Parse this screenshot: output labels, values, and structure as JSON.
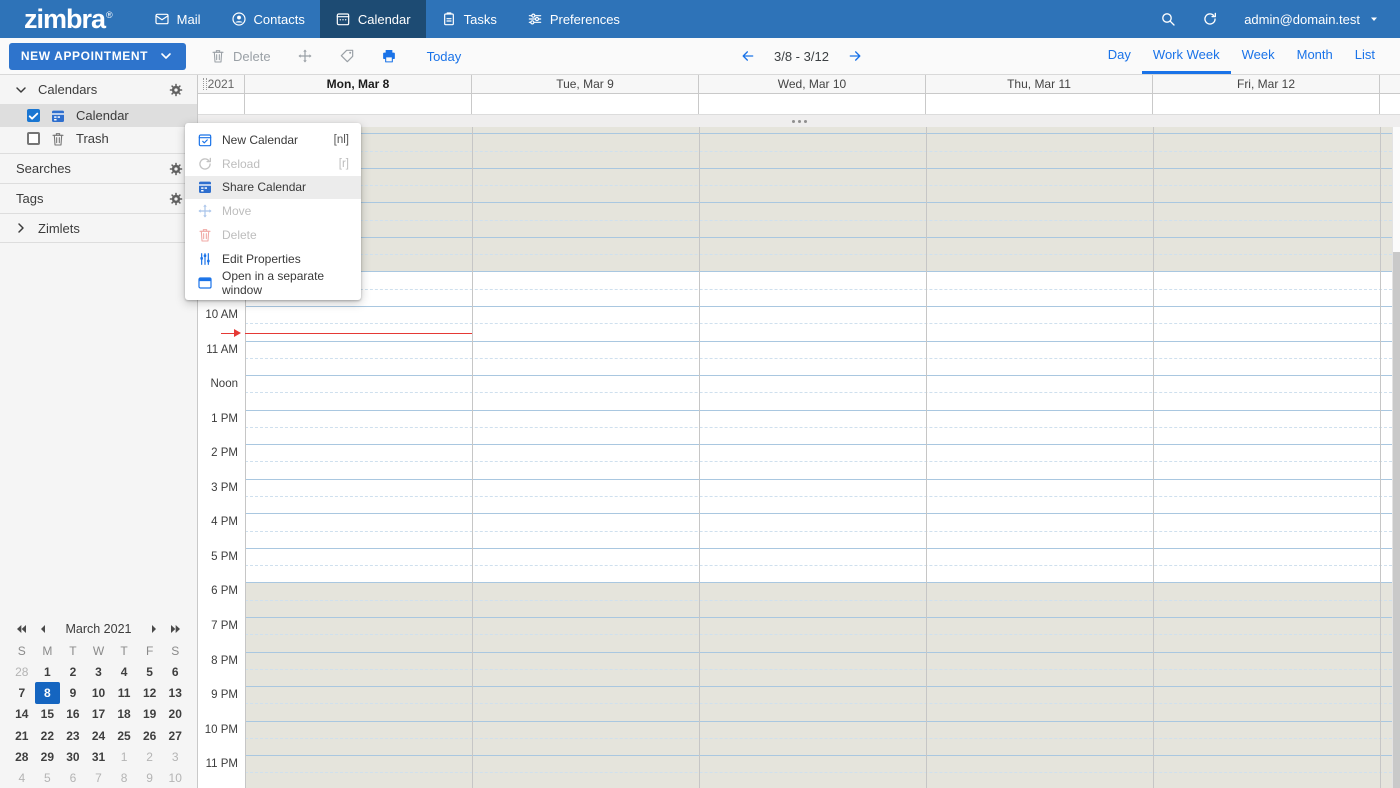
{
  "colors": {
    "topbar-bg": "#2e73b8",
    "topbar-active": "#1d4b73",
    "accent": "#1a73e8",
    "button-blue": "#2e74cc",
    "toolbar-bg": "#fafafa",
    "sidebar-bg": "#f5f5f5",
    "row-selected": "#dedede",
    "menu-highlight": "#ececec",
    "grid-shaded": "#e5e4dc",
    "hour-line": "#a9c7e0",
    "half-line": "#cfe0ee",
    "col-border": "#c6c6c6",
    "header-bg": "#f7f7f7",
    "current-time": "#e53935",
    "minical-selected": "#1565c0",
    "disabled-text": "#bdbdbd",
    "muted-text": "#9e9e9e"
  },
  "topbar": {
    "logo": "zimbra",
    "registered": "®",
    "tabs": [
      {
        "label": "Mail",
        "icon": "mail-icon",
        "active": false
      },
      {
        "label": "Contacts",
        "icon": "contacts-icon",
        "active": false
      },
      {
        "label": "Calendar",
        "icon": "calendar-icon",
        "active": true
      },
      {
        "label": "Tasks",
        "icon": "tasks-icon",
        "active": false
      },
      {
        "label": "Preferences",
        "icon": "preferences-icon",
        "active": false
      }
    ],
    "account": "admin@domain.test"
  },
  "toolbar": {
    "new_appointment_label": "NEW APPOINTMENT",
    "delete_label": "Delete",
    "today_label": "Today",
    "date_range": "3/8 - 3/12",
    "views": [
      {
        "label": "Day",
        "active": false
      },
      {
        "label": "Work Week",
        "active": true
      },
      {
        "label": "Week",
        "active": false
      },
      {
        "label": "Month",
        "active": false
      },
      {
        "label": "List",
        "active": false
      }
    ]
  },
  "sidebar": {
    "calendars_header": "Calendars",
    "calendar_items": [
      {
        "label": "Calendar",
        "checked": true,
        "icon": "calendar-solid-icon",
        "selected": true
      },
      {
        "label": "Trash",
        "checked": false,
        "icon": "trash-icon",
        "selected": false
      }
    ],
    "sections": [
      {
        "label": "Searches"
      },
      {
        "label": "Tags"
      }
    ],
    "zimlets_label": "Zimlets"
  },
  "context_menu": {
    "items": [
      {
        "label": "New Calendar",
        "shortcut": "[nl]",
        "icon": "new-calendar-icon",
        "state": "normal",
        "icon_class": "mi-blue"
      },
      {
        "label": "Reload",
        "shortcut": "[r]",
        "icon": "reload-icon",
        "state": "disabled",
        "icon_class": "mi-grey"
      },
      {
        "label": "Share Calendar",
        "shortcut": "",
        "icon": "share-calendar-icon",
        "state": "highlighted",
        "icon_class": "mi-fillblue"
      },
      {
        "label": "Move",
        "shortcut": "",
        "icon": "move-icon",
        "state": "disabled",
        "icon_class": "mi-lightblue"
      },
      {
        "label": "Delete",
        "shortcut": "",
        "icon": "trash-icon",
        "state": "disabled",
        "icon_class": "mi-lightred"
      },
      {
        "label": "Edit Properties",
        "shortcut": "",
        "icon": "edit-properties-icon",
        "state": "normal",
        "icon_class": "mi-blue"
      },
      {
        "label": "Open in a separate window",
        "shortcut": "",
        "icon": "window-icon",
        "state": "normal",
        "icon_class": "mi-blue"
      }
    ]
  },
  "mini_calendar": {
    "title": "March 2021",
    "weekdays": [
      "S",
      "M",
      "T",
      "W",
      "T",
      "F",
      "S"
    ],
    "weeks": [
      [
        {
          "d": "28",
          "muted": true
        },
        {
          "d": "1"
        },
        {
          "d": "2"
        },
        {
          "d": "3"
        },
        {
          "d": "4"
        },
        {
          "d": "5"
        },
        {
          "d": "6"
        }
      ],
      [
        {
          "d": "7"
        },
        {
          "d": "8",
          "selected": true
        },
        {
          "d": "9"
        },
        {
          "d": "10"
        },
        {
          "d": "11"
        },
        {
          "d": "12"
        },
        {
          "d": "13"
        }
      ],
      [
        {
          "d": "14"
        },
        {
          "d": "15"
        },
        {
          "d": "16"
        },
        {
          "d": "17"
        },
        {
          "d": "18"
        },
        {
          "d": "19"
        },
        {
          "d": "20"
        }
      ],
      [
        {
          "d": "21"
        },
        {
          "d": "22"
        },
        {
          "d": "23"
        },
        {
          "d": "24"
        },
        {
          "d": "25"
        },
        {
          "d": "26"
        },
        {
          "d": "27"
        }
      ],
      [
        {
          "d": "28"
        },
        {
          "d": "29"
        },
        {
          "d": "30"
        },
        {
          "d": "31"
        },
        {
          "d": "1",
          "muted": true
        },
        {
          "d": "2",
          "muted": true
        },
        {
          "d": "3",
          "muted": true
        }
      ],
      [
        {
          "d": "4",
          "muted": true
        },
        {
          "d": "5",
          "muted": true
        },
        {
          "d": "6",
          "muted": true
        },
        {
          "d": "7",
          "muted": true
        },
        {
          "d": "8",
          "muted": true
        },
        {
          "d": "9",
          "muted": true
        },
        {
          "d": "10",
          "muted": true
        }
      ]
    ]
  },
  "calendar": {
    "year_label": "2021",
    "day_headers": [
      {
        "label": "Mon, Mar 8",
        "today": true
      },
      {
        "label": "Tue, Mar 9",
        "today": false
      },
      {
        "label": "Wed, Mar 10",
        "today": false
      },
      {
        "label": "Thu, Mar 11",
        "today": false
      },
      {
        "label": "Fri, Mar 12",
        "today": false
      }
    ],
    "hour_labels": [
      {
        "hour": 10,
        "label": "10 AM"
      },
      {
        "hour": 11,
        "label": "11 AM"
      },
      {
        "hour": 12,
        "label": "Noon"
      },
      {
        "hour": 13,
        "label": "1 PM"
      },
      {
        "hour": 14,
        "label": "2 PM"
      },
      {
        "hour": 15,
        "label": "3 PM"
      },
      {
        "hour": 16,
        "label": "4 PM"
      },
      {
        "hour": 17,
        "label": "5 PM"
      },
      {
        "hour": 18,
        "label": "6 PM"
      },
      {
        "hour": 19,
        "label": "7 PM"
      },
      {
        "hour": 20,
        "label": "8 PM"
      },
      {
        "hour": 21,
        "label": "9 PM"
      },
      {
        "hour": 22,
        "label": "10 PM"
      },
      {
        "hour": 23,
        "label": "11 PM"
      }
    ]
  }
}
